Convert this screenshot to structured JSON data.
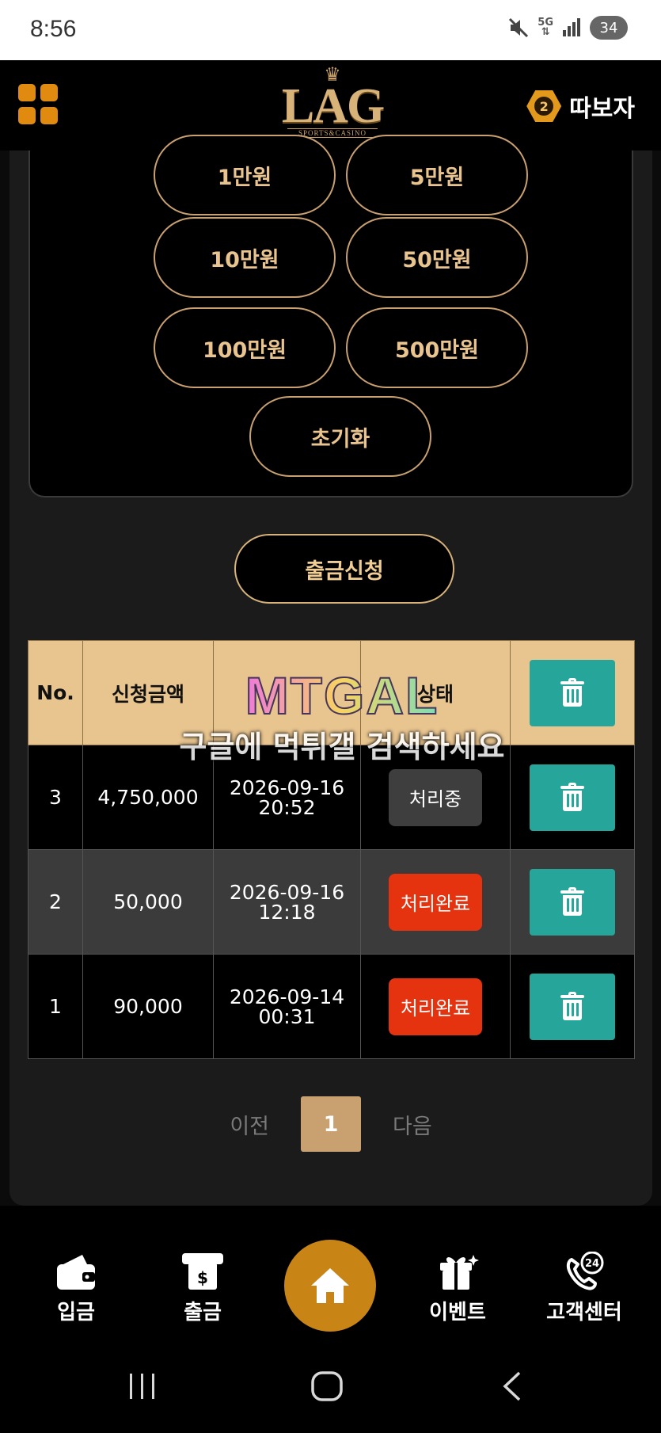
{
  "status_bar": {
    "time": "8:56",
    "network": "5G",
    "battery": "34"
  },
  "header": {
    "logo_text": "LAG",
    "logo_sub": "SPORTS&CASINO",
    "level": "2",
    "username": "따보자"
  },
  "amount_buttons": [
    "1만원",
    "5만원",
    "10만원",
    "50만원",
    "100만원",
    "500만원"
  ],
  "reset_label": "초기화",
  "withdraw_label": "출금신청",
  "table": {
    "headers": {
      "no": "No.",
      "amount": "신청금액",
      "status": "상태"
    },
    "rows": [
      {
        "no": "3",
        "amount": "4,750,000",
        "date": "2026-09-16",
        "time": "20:52",
        "status": "처리중",
        "status_color": "#3e3e3e"
      },
      {
        "no": "2",
        "amount": "50,000",
        "date": "2026-09-16",
        "time": "12:18",
        "status": "처리완료",
        "status_color": "#e5320f"
      },
      {
        "no": "1",
        "amount": "90,000",
        "date": "2026-09-14",
        "time": "00:31",
        "status": "처리완료",
        "status_color": "#e5320f"
      }
    ]
  },
  "watermark": {
    "logo": "MTGAL",
    "text": "구글에 먹튀갤 검색하세요"
  },
  "pagination": {
    "prev": "이전",
    "current": "1",
    "next": "다음"
  },
  "bottom_nav": {
    "deposit": "입금",
    "withdraw": "출금",
    "event": "이벤트",
    "support": "고객센터",
    "support_badge": "24"
  },
  "colors": {
    "accent": "#c98416",
    "gold": "#e8c48f",
    "delete": "#26a69a",
    "done": "#e5320f"
  }
}
